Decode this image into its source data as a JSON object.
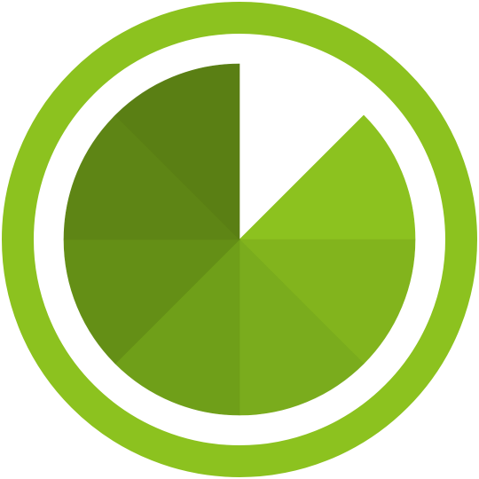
{
  "icon": {
    "name": "pie-timer-icon",
    "ring_color": "#8cc21f",
    "progress_fraction": 0.875,
    "segments": [
      {
        "color": "#8cc21f"
      },
      {
        "color": "#82b41d"
      },
      {
        "color": "#7aac1d"
      },
      {
        "color": "#6f9f19"
      },
      {
        "color": "#648f16"
      },
      {
        "color": "#5e8515"
      },
      {
        "color": "#5a7f14"
      }
    ]
  }
}
